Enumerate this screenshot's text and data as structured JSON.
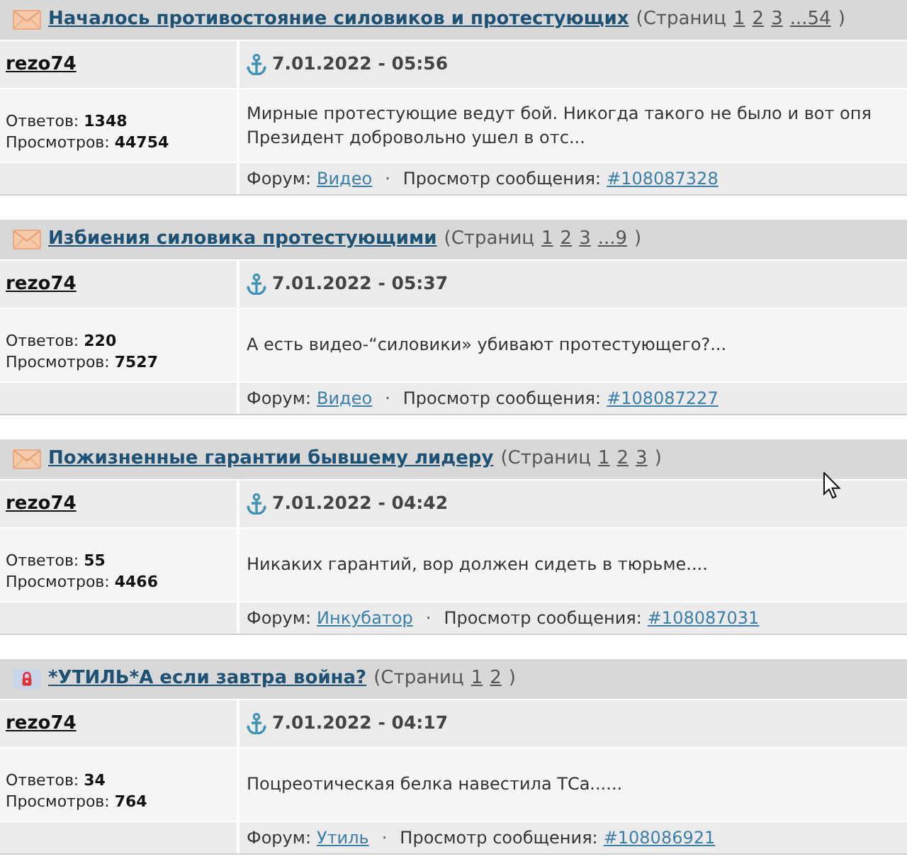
{
  "posts": [
    {
      "title": "Началось противостояние силовиков и протестующих",
      "locked": false,
      "pages_label": "(Страниц",
      "pages": [
        "1",
        "2",
        "3",
        "...54"
      ],
      "pages_close": ")",
      "author": "rezo74",
      "date": "7.01.2022 - 05:56",
      "replies_label": "Ответов:",
      "replies": "1348",
      "views_label": "Просмотров:",
      "views": "44754",
      "message": "Мирные протестующие ведут бой. Никогда такого не было и вот опя\nПрезидент добровольно ушел в отс...",
      "forum_label": "Форум:",
      "forum": "Видео",
      "separator": "·",
      "view_label": "Просмотр сообщения:",
      "message_link": "#108087328"
    },
    {
      "title": "Избиения силовика протестующими",
      "locked": false,
      "pages_label": "(Страниц",
      "pages": [
        "1",
        "2",
        "3",
        "...9"
      ],
      "pages_close": ")",
      "author": "rezo74",
      "date": "7.01.2022 - 05:37",
      "replies_label": "Ответов:",
      "replies": "220",
      "views_label": "Просмотров:",
      "views": "7527",
      "message": "А есть видео-“силовики» убивают протестующего?...",
      "forum_label": "Форум:",
      "forum": "Видео",
      "separator": "·",
      "view_label": "Просмотр сообщения:",
      "message_link": "#108087227"
    },
    {
      "title": "Пожизненные гарантии бывшему лидеру",
      "locked": false,
      "pages_label": "(Страниц",
      "pages": [
        "1",
        "2",
        "3"
      ],
      "pages_close": ")",
      "author": "rezo74",
      "date": "7.01.2022 - 04:42",
      "replies_label": "Ответов:",
      "replies": "55",
      "views_label": "Просмотров:",
      "views": "4466",
      "message": "Никаких гарантий, вор должен сидеть в тюрьме....",
      "forum_label": "Форум:",
      "forum": "Инкубатор",
      "separator": "·",
      "view_label": "Просмотр сообщения:",
      "message_link": "#108087031"
    },
    {
      "title": "*УТИЛЬ*А если завтра война?",
      "locked": true,
      "pages_label": "(Страниц",
      "pages": [
        "1",
        "2"
      ],
      "pages_close": ")",
      "author": "rezo74",
      "date": "7.01.2022 - 04:17",
      "replies_label": "Ответов:",
      "replies": "34",
      "views_label": "Просмотров:",
      "views": "764",
      "message": "Поцреотическая белка навестила ТСа......",
      "forum_label": "Форум:",
      "forum": "Утиль",
      "separator": "·",
      "view_label": "Просмотр сообщения:",
      "message_link": "#108086921"
    }
  ]
}
